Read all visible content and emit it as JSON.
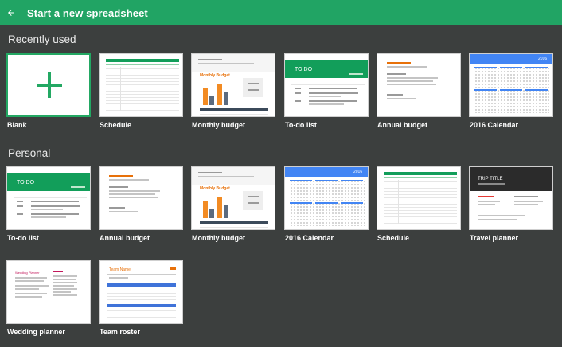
{
  "header": {
    "title": "Start a new spreadsheet",
    "back_icon": "arrow-back-icon",
    "bg_color": "#21a464"
  },
  "sections": {
    "recent": {
      "title": "Recently used"
    },
    "personal": {
      "title": "Personal"
    }
  },
  "recent_templates": [
    {
      "label": "Blank"
    },
    {
      "label": "Schedule"
    },
    {
      "label": "Monthly budget"
    },
    {
      "label": "To-do list"
    },
    {
      "label": "Annual budget"
    },
    {
      "label": "2016 Calendar"
    }
  ],
  "personal_templates": [
    {
      "label": "To-do list"
    },
    {
      "label": "Annual budget"
    },
    {
      "label": "Monthly budget"
    },
    {
      "label": "2016 Calendar"
    },
    {
      "label": "Schedule"
    },
    {
      "label": "Travel planner"
    },
    {
      "label": "Wedding planner"
    },
    {
      "label": "Team roster"
    }
  ],
  "thumb_text": {
    "todo": "TO DO",
    "monthly_budget": "Monthly Budget",
    "year": "2016",
    "trip_title": "TRIP TITLE",
    "wedding": "Wedding Planner",
    "team_name": "Team Name"
  }
}
